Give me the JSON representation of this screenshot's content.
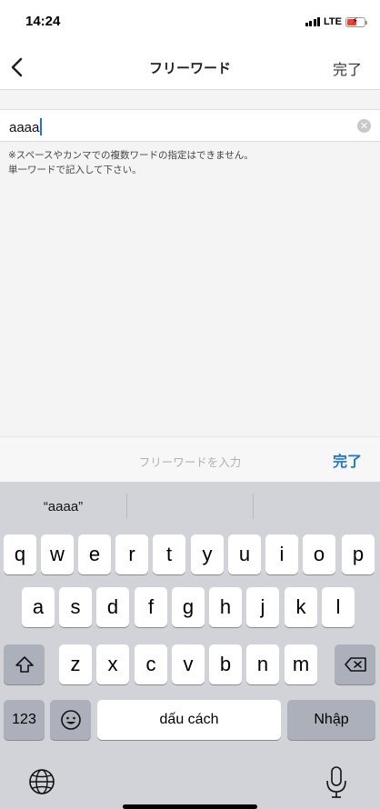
{
  "status": {
    "time": "14:24",
    "network": "LTE",
    "battery_color": "#ff3b30"
  },
  "nav": {
    "title": "フリーワード",
    "done_label": "完了"
  },
  "search": {
    "value": "aaaa",
    "note_line1": "※スペースやカンマでの複数ワードの指定はできません。",
    "note_line2": "単一ワードで記入して下さい。"
  },
  "accessory": {
    "placeholder": "フリーワードを入力",
    "done_label": "完了",
    "accent": "#1a73e8"
  },
  "keyboard": {
    "suggestions": [
      "“aaaa”",
      "",
      ""
    ],
    "row1": [
      "q",
      "w",
      "e",
      "r",
      "t",
      "y",
      "u",
      "i",
      "o",
      "p"
    ],
    "row2": [
      "a",
      "s",
      "d",
      "f",
      "g",
      "h",
      "j",
      "k",
      "l"
    ],
    "row3": [
      "z",
      "x",
      "c",
      "v",
      "b",
      "n",
      "m"
    ],
    "numbers_label": "123",
    "space_label": "dấu cách",
    "enter_label": "Nhập"
  }
}
